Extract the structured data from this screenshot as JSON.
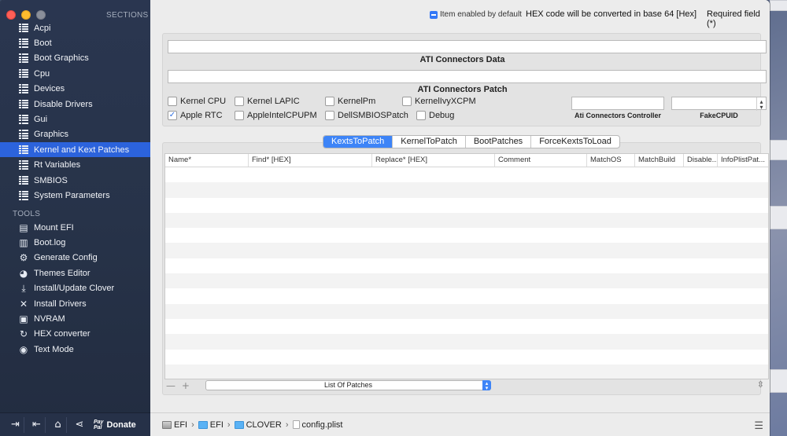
{
  "sidebar": {
    "sections_header": "SECTIONS",
    "tools_header": "TOOLS",
    "sections": [
      {
        "label": "Acpi",
        "icon": "list-icon"
      },
      {
        "label": "Boot",
        "icon": "list-icon"
      },
      {
        "label": "Boot Graphics",
        "icon": "list-icon"
      },
      {
        "label": "Cpu",
        "icon": "list-icon"
      },
      {
        "label": "Devices",
        "icon": "list-icon"
      },
      {
        "label": "Disable Drivers",
        "icon": "list-icon"
      },
      {
        "label": "Gui",
        "icon": "list-icon"
      },
      {
        "label": "Graphics",
        "icon": "list-icon"
      },
      {
        "label": "Kernel and Kext Patches",
        "icon": "list-icon",
        "selected": true
      },
      {
        "label": "Rt Variables",
        "icon": "list-icon"
      },
      {
        "label": "SMBIOS",
        "icon": "list-icon"
      },
      {
        "label": "System Parameters",
        "icon": "list-icon"
      }
    ],
    "tools": [
      {
        "label": "Mount EFI",
        "icon": "disk-icon"
      },
      {
        "label": "Boot.log",
        "icon": "document-icon"
      },
      {
        "label": "Generate Config",
        "icon": "gear-icon"
      },
      {
        "label": "Themes Editor",
        "icon": "palette-icon"
      },
      {
        "label": "Install/Update Clover",
        "icon": "download-icon"
      },
      {
        "label": "Install Drivers",
        "icon": "wrench-icon"
      },
      {
        "label": "NVRAM",
        "icon": "chip-icon"
      },
      {
        "label": "HEX converter",
        "icon": "refresh-icon"
      },
      {
        "label": "Text Mode",
        "icon": "eye-icon"
      }
    ],
    "bottom": {
      "paypal_line1": "Pay",
      "paypal_line2": "Pal",
      "donate_label": "Donate"
    }
  },
  "topbar": {
    "legend_text": "Item enabled by default",
    "hex_note": "HEX code will be converted in base 64 [Hex]",
    "required_note": "Required field (*)"
  },
  "ati": {
    "connectors_data_label": "ATI Connectors Data",
    "connectors_data_value": "",
    "connectors_patch_label": "ATI Connectors Patch",
    "connectors_patch_value": "",
    "controller_label": "Ati Connectors Controller",
    "controller_value": "",
    "fakecpuid_label": "FakeCPUID",
    "fakecpuid_value": ""
  },
  "checkboxes": [
    {
      "label": "Kernel CPU",
      "checked": false
    },
    {
      "label": "Kernel LAPIC",
      "checked": false
    },
    {
      "label": "KernelPm",
      "checked": false
    },
    {
      "label": "KernelIvyXCPM",
      "checked": false
    },
    {
      "label": "Apple RTC",
      "checked": true
    },
    {
      "label": "AppleIntelCPUPM",
      "checked": false
    },
    {
      "label": "DellSMBIOSPatch",
      "checked": false
    },
    {
      "label": "Debug",
      "checked": false
    }
  ],
  "tabs": [
    {
      "label": "KextsToPatch",
      "active": true
    },
    {
      "label": "KernelToPatch",
      "active": false
    },
    {
      "label": "BootPatches",
      "active": false
    },
    {
      "label": "ForceKextsToLoad",
      "active": false
    }
  ],
  "table": {
    "columns": [
      "Name*",
      "Find* [HEX]",
      "Replace* [HEX]",
      "Comment",
      "MatchOS",
      "MatchBuild",
      "Disable...",
      "InfoPlistPat..."
    ],
    "rows": []
  },
  "footer": {
    "add_remove": "— +",
    "popup_value": "List Of Patches"
  },
  "pathbar": {
    "crumbs": [
      {
        "label": "EFI",
        "icon": "drive-icon"
      },
      {
        "label": "EFI",
        "icon": "folder-icon"
      },
      {
        "label": "CLOVER",
        "icon": "folder-icon"
      },
      {
        "label": "config.plist",
        "icon": "file-icon"
      }
    ]
  }
}
